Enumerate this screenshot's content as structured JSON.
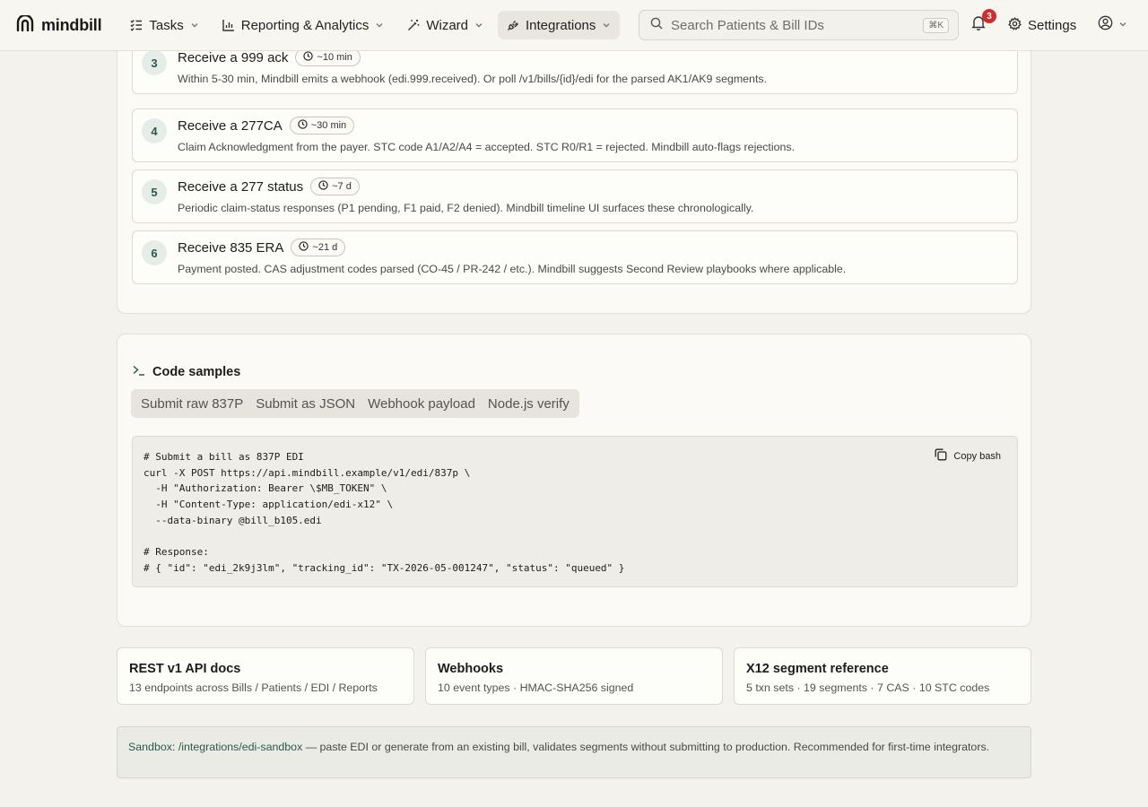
{
  "brand": {
    "name": "mindbill"
  },
  "nav": {
    "items": [
      {
        "label": "Tasks"
      },
      {
        "label": "Reporting & Analytics"
      },
      {
        "label": "Wizard"
      },
      {
        "label": "Integrations"
      }
    ],
    "active": "Integrations"
  },
  "search": {
    "placeholder": "Search Patients & Bill IDs",
    "shortcut": "⌘K"
  },
  "notifications": {
    "count": "3"
  },
  "settings": {
    "label": "Settings"
  },
  "steps": [
    {
      "num": "3",
      "title": "Receive a 999 ack",
      "eta": "~10 min",
      "desc": "Within 5-30 min, Mindbill emits a webhook (edi.999.received). Or poll /v1/bills/{id}/edi for the parsed AK1/AK9 segments."
    },
    {
      "num": "4",
      "title": "Receive a 277CA",
      "eta": "~30 min",
      "desc": "Claim Acknowledgment from the payer. STC code A1/A2/A4 = accepted. STC R0/R1 = rejected. Mindbill auto-flags rejections."
    },
    {
      "num": "5",
      "title": "Receive a 277 status",
      "eta": "~7 d",
      "desc": "Periodic claim-status responses (P1 pending, F1 paid, F2 denied). Mindbill timeline UI surfaces these chronologically."
    },
    {
      "num": "6",
      "title": "Receive 835 ERA",
      "eta": "~21 d",
      "desc": "Payment posted. CAS adjustment codes parsed (CO-45 / PR-242 / etc.). Mindbill suggests Second Review playbooks where applicable."
    }
  ],
  "code_samples": {
    "title": "Code samples",
    "tabs": [
      "Submit raw 837P",
      "Submit as JSON",
      "Webhook payload",
      "Node.js verify"
    ],
    "copy_label": "Copy bash",
    "code": "# Submit a bill as 837P EDI\ncurl -X POST https://api.mindbill.example/v1/edi/837p \\\n  -H \"Authorization: Bearer \\$MB_TOKEN\" \\\n  -H \"Content-Type: application/edi-x12\" \\\n  --data-binary @bill_b105.edi\n\n# Response:\n# { \"id\": \"edi_2k9j3lm\", \"tracking_id\": \"TX-2026-05-001247\", \"status\": \"queued\" }"
  },
  "links": [
    {
      "title": "REST v1 API docs",
      "sub": "13 endpoints across Bills / Patients / EDI / Reports"
    },
    {
      "title": "Webhooks",
      "sub": "10 event types · HMAC-SHA256 signed"
    },
    {
      "title": "X12 segment reference",
      "sub": "5 txn sets · 19 segments · 7 CAS · 10 STC codes"
    }
  ],
  "sandbox": {
    "label": "Sandbox:",
    "link": "/integrations/edi-sandbox",
    "text": " — paste EDI or generate from an existing bill, validates segments without submitting to production. Recommended for first-time integrators."
  },
  "colors": {
    "accent": "#2c5a4e",
    "badge": "#d12d2d",
    "background": "#f4f2ec"
  }
}
